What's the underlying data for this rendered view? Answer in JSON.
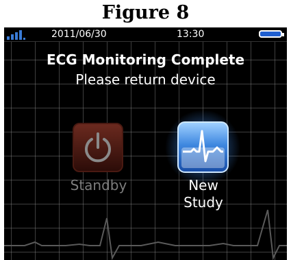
{
  "figure_title": "Figure 8",
  "status_bar": {
    "date": "2011/06/30",
    "time": "13:30",
    "signal_icon": "signal-strength-icon",
    "battery_icon": "battery-icon"
  },
  "screen": {
    "headline": "ECG Monitoring Complete",
    "subline": "Please return device"
  },
  "buttons": {
    "standby": {
      "label": "Standby",
      "icon": "power-icon",
      "enabled": false
    },
    "new_study": {
      "label_line1": "New",
      "label_line2": "Study",
      "icon": "ecg-heartbeat-icon",
      "enabled": true
    }
  },
  "colors": {
    "screen_background": "#000000",
    "standby_tile": "#6b2a1f",
    "new_study_tile": "#3f88e0",
    "battery_fill": "#1f5fd0",
    "signal_bars": "#3a7bd5"
  }
}
